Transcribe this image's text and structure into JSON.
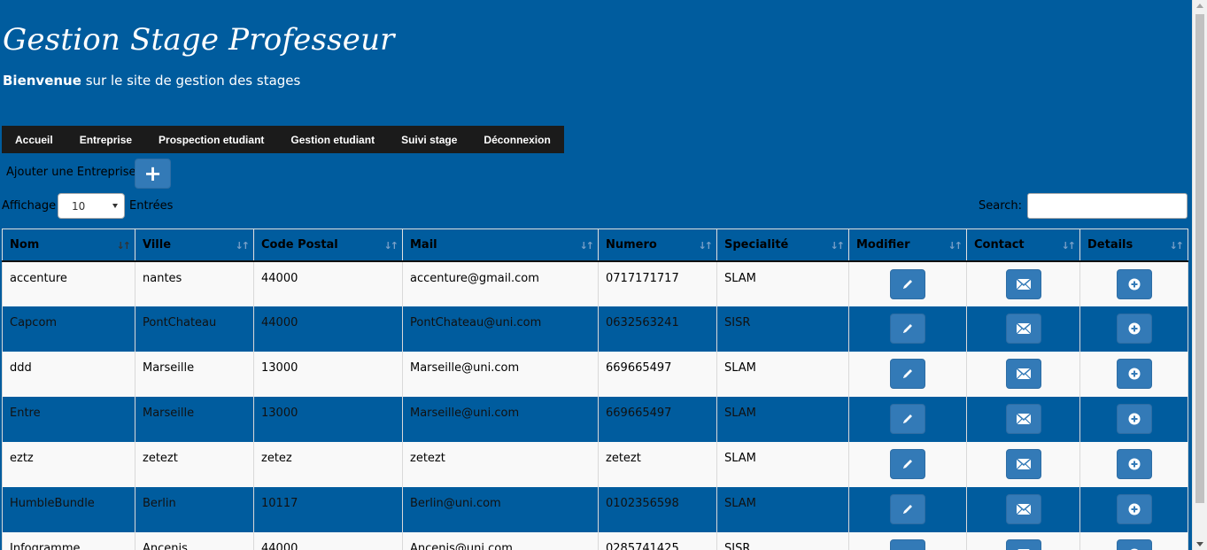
{
  "header": {
    "title": "Gestion Stage Professeur",
    "subtitle_bold": "Bienvenue",
    "subtitle_rest": " sur le site de gestion des stages"
  },
  "nav": {
    "items": [
      "Accueil",
      "Entreprise",
      "Prospection etudiant",
      "Gestion etudiant",
      "Suivi stage",
      "Déconnexion"
    ]
  },
  "toolbar": {
    "add_label": "Ajouter une Entreprise",
    "add_icon": "plus-icon",
    "length_label": "Affichage",
    "length_value": "10",
    "length_suffix": "Entrées",
    "search_label": "Search:",
    "search_value": ""
  },
  "table": {
    "columns": [
      "Nom",
      "Ville",
      "Code Postal",
      "Mail",
      "Numero",
      "Specialité",
      "Modifier",
      "Contact",
      "Details"
    ],
    "sorted_column": "Nom",
    "rows": [
      [
        "accenture",
        "nantes",
        "44000",
        "accenture@gmail.com",
        "0717171717",
        "SLAM"
      ],
      [
        "Capcom",
        "PontChateau",
        "44000",
        "PontChateau@uni.com",
        "0632563241",
        "SISR"
      ],
      [
        "ddd",
        "Marseille",
        "13000",
        "Marseille@uni.com",
        "669665497",
        "SLAM"
      ],
      [
        "Entre",
        "Marseille",
        "13000",
        "Marseille@uni.com",
        "669665497",
        "SLAM"
      ],
      [
        "eztz",
        "zetezt",
        "zetez",
        "zetezt",
        "zetezt",
        "SLAM"
      ],
      [
        "HumbleBundle",
        "Berlin",
        "10117",
        "Berlin@uni.com",
        "0102356598",
        "SLAM"
      ],
      [
        "Infogramme",
        "Ancenis",
        "44000",
        "Ancenis@uni.com",
        "0285741425",
        "SISR"
      ]
    ],
    "action_icons": [
      "pencil-icon",
      "envelope-icon",
      "plus-circle-icon"
    ]
  },
  "colors": {
    "background": "#005c9e",
    "navbar": "#1b1b1b",
    "button": "#337ab7",
    "row_light": "#f9f9f9"
  }
}
